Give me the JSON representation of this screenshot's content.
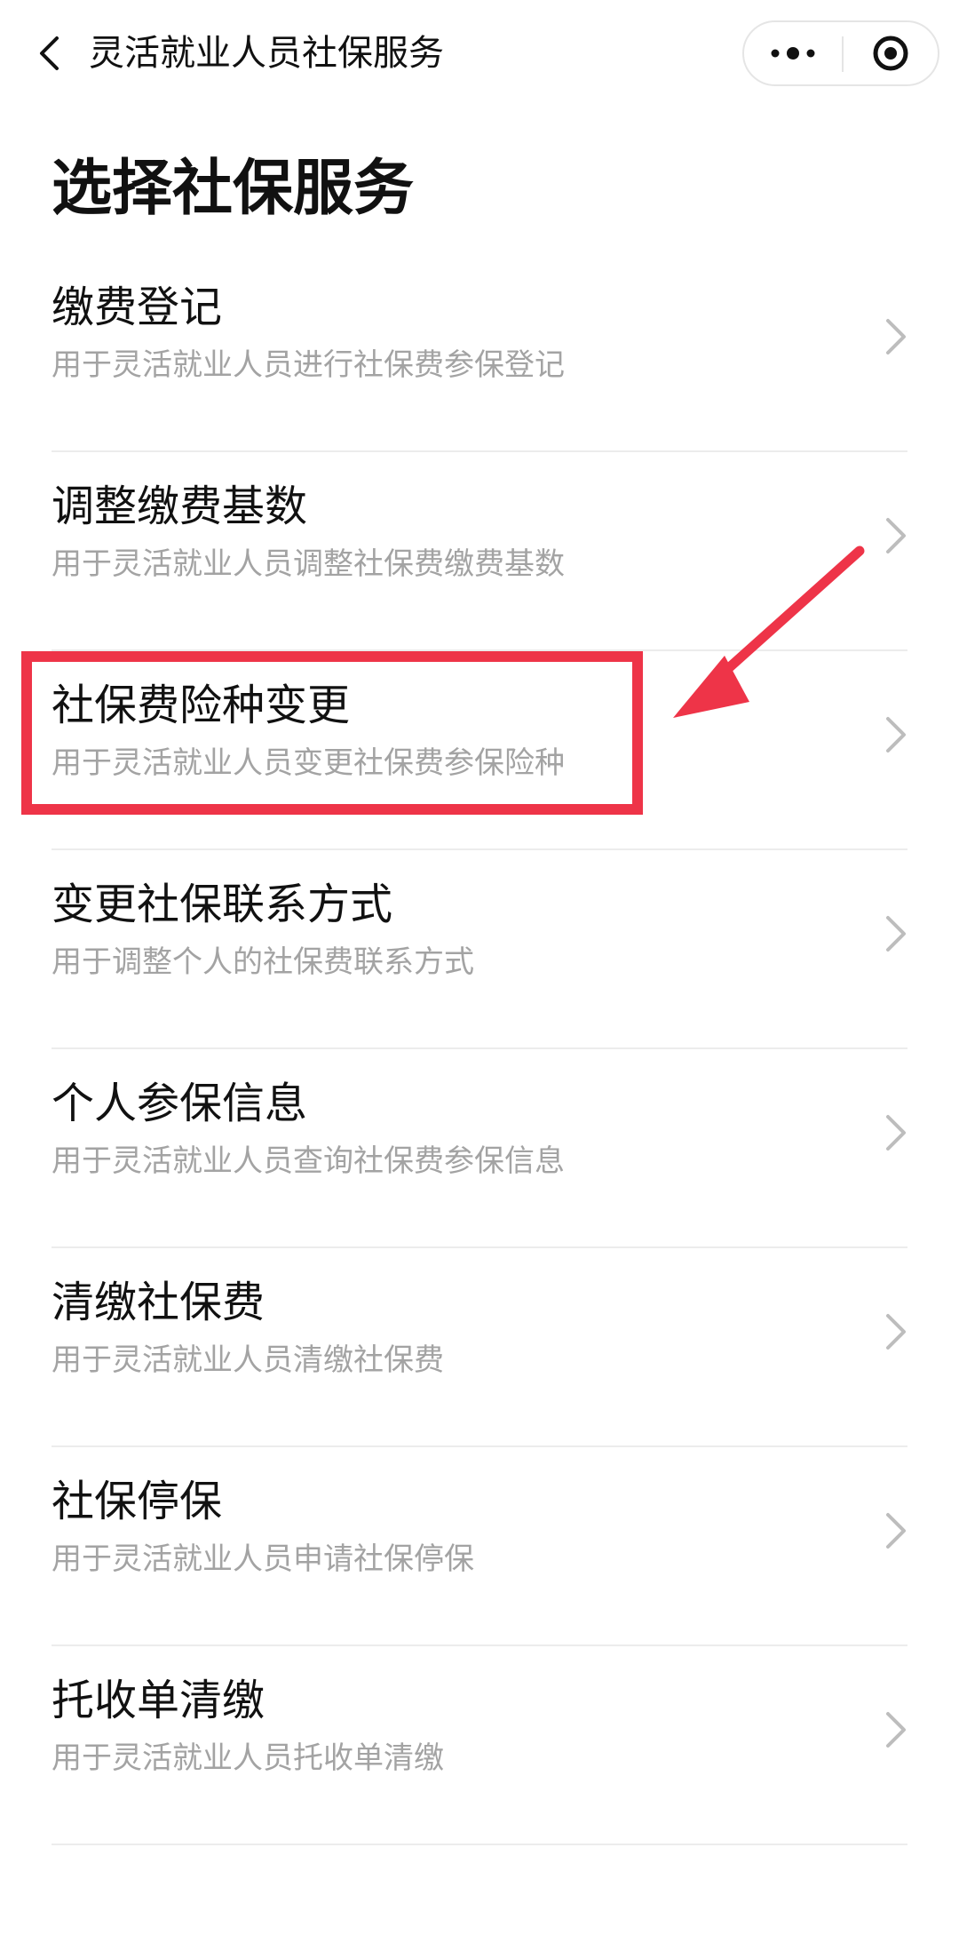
{
  "header": {
    "title": "灵活就业人员社保服务",
    "back_icon": "chevron-left-icon",
    "more_icon": "more-dots-icon",
    "close_icon": "target-circle-icon"
  },
  "page": {
    "heading": "选择社保服务"
  },
  "services": [
    {
      "title": "缴费登记",
      "description": "用于灵活就业人员进行社保费参保登记"
    },
    {
      "title": "调整缴费基数",
      "description": "用于灵活就业人员调整社保费缴费基数"
    },
    {
      "title": "社保费险种变更",
      "description": "用于灵活就业人员变更社保费参保险种"
    },
    {
      "title": "变更社保联系方式",
      "description": "用于调整个人的社保费联系方式"
    },
    {
      "title": "个人参保信息",
      "description": "用于灵活就业人员查询社保费参保信息"
    },
    {
      "title": "清缴社保费",
      "description": "用于灵活就业人员清缴社保费"
    },
    {
      "title": "社保停保",
      "description": "用于灵活就业人员申请社保停保"
    },
    {
      "title": "托收单清缴",
      "description": "用于灵活就业人员托收单清缴"
    }
  ],
  "annotation": {
    "highlight_color": "#ee3448",
    "arrow_color": "#ee3448",
    "highlighted_index": 2
  },
  "colors": {
    "text_primary": "#111111",
    "text_secondary": "#a3a3a3",
    "divider": "#ececec",
    "chevron": "#bdbdbd"
  }
}
